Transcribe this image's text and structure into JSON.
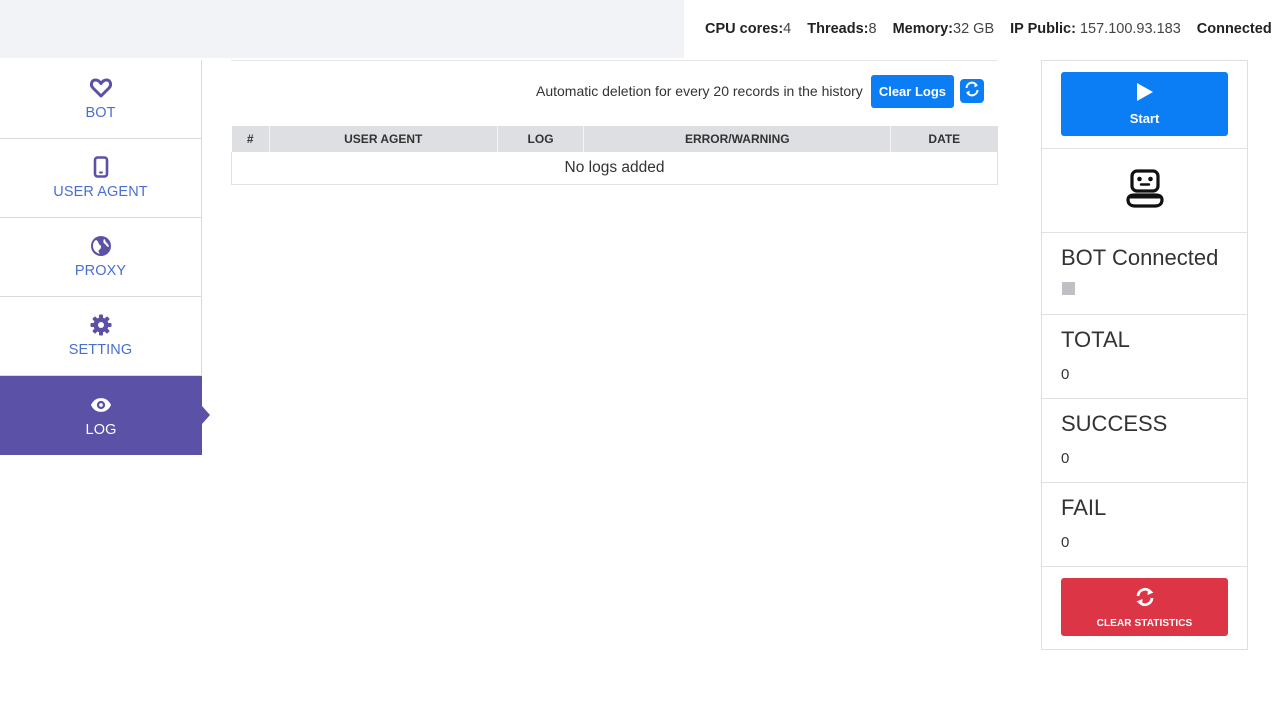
{
  "topbar": {
    "cpu_label": "CPU cores:",
    "cpu_value": "4",
    "threads_label": "Threads:",
    "threads_value": "8",
    "memory_label": "Memory:",
    "memory_value": "32 GB",
    "ip_label": "IP Public:",
    "ip_value": "157.100.93.183",
    "connection_status": "Connected"
  },
  "sidebar": {
    "items": [
      {
        "label": "BOT",
        "icon": "heart-icon"
      },
      {
        "label": "USER AGENT",
        "icon": "mobile-icon"
      },
      {
        "label": "PROXY",
        "icon": "globe-icon"
      },
      {
        "label": "SETTING",
        "icon": "gear-icon"
      },
      {
        "label": "LOG",
        "icon": "eye-icon"
      }
    ],
    "active": "LOG"
  },
  "main": {
    "auto_delete_note": "Automatic deletion for every 20 records in the history",
    "clear_logs_label": "Clear Logs",
    "refresh_icon": "refresh-icon",
    "table": {
      "columns": [
        "#",
        "USER AGENT",
        "LOG",
        "ERROR/WARNING",
        "DATE"
      ],
      "empty_message": "No logs added"
    }
  },
  "panel": {
    "start_label": "Start",
    "bot_icon": "robot-icon",
    "bot_status_title": "BOT Connected",
    "total_label": "TOTAL",
    "total_value": "0",
    "success_label": "SUCCESS",
    "success_value": "0",
    "fail_label": "FAIL",
    "fail_value": "0",
    "clear_stats_label": "CLEAR STATISTICS"
  },
  "colors": {
    "accent_blue": "#0b7df5",
    "nav_active": "#5b51a6",
    "nav_text": "#4a6fd1",
    "danger": "#dc3545"
  }
}
